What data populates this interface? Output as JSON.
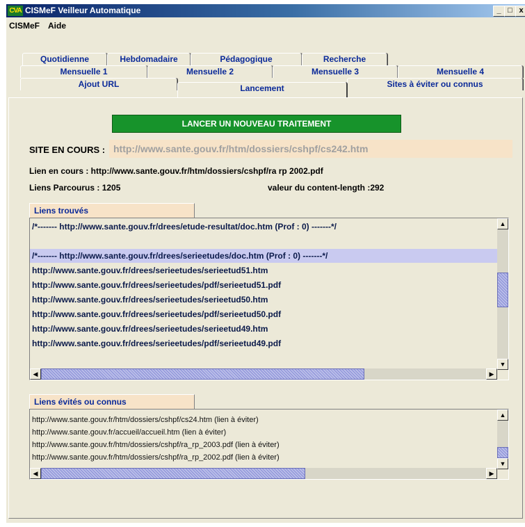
{
  "window": {
    "logo": "CVA",
    "title": "CISMeF Veilleur Automatique",
    "controls": [
      "_",
      "□",
      "x"
    ]
  },
  "menu": [
    "CISMeF",
    "Aide"
  ],
  "tabs": {
    "row1": [
      "Quotidienne",
      "Hebdomadaire",
      "Pédagogique",
      "Recherche"
    ],
    "row2": [
      "Mensuelle 1",
      "Mensuelle 2",
      "Mensuelle 3",
      "Mensuelle 4"
    ],
    "row3": [
      "Ajout URL",
      "Lancement",
      "Sites  à  éviter ou connus"
    ],
    "active": "Lancement"
  },
  "launch_button": "LANCER UN NOUVEAU TRAITEMENT",
  "site": {
    "label": "SITE EN COURS :",
    "value": "http://www.sante.gouv.fr/htm/dossiers/cshpf/cs242.htm"
  },
  "status": {
    "current_link": "Lien en cours : http://www.sante.gouv.fr/htm/dossiers/cshpf/ra  rp  2002.pdf",
    "links_visited": "Liens Parcourus : 1205",
    "content_length": "valeur du content-length :292"
  },
  "found": {
    "label": "Liens trouvés",
    "rows": [
      "/*-------   http://www.sante.gouv.fr/drees/etude-resultat/doc.htm (Prof : 0)   -------*/",
      "",
      "/*-------   http://www.sante.gouv.fr/drees/serieetudes/doc.htm (Prof : 0)   -------*/",
      "http://www.sante.gouv.fr/drees/serieetudes/serieetud51.htm",
      "http://www.sante.gouv.fr/drees/serieetudes/pdf/serieetud51.pdf",
      "http://www.sante.gouv.fr/drees/serieetudes/serieetud50.htm",
      "http://www.sante.gouv.fr/drees/serieetudes/pdf/serieetud50.pdf",
      "http://www.sante.gouv.fr/drees/serieetudes/serieetud49.htm",
      "http://www.sante.gouv.fr/drees/serieetudes/pdf/serieetud49.pdf"
    ]
  },
  "avoided": {
    "label": "Liens évités ou connus",
    "rows": [
      "http://www.sante.gouv.fr/htm/dossiers/cshpf/cs24.htm (lien à éviter)",
      "http://www.sante.gouv.fr/accueil/accueil.htm (lien à éviter)",
      "http://www.sante.gouv.fr/htm/dossiers/cshpf/ra_rp_2003.pdf (lien à éviter)",
      "http://www.sante.gouv.fr/htm/dossiers/cshpf/ra_rp_2002.pdf (lien à éviter)"
    ]
  },
  "scroll_glyphs": {
    "up": "▲",
    "down": "▼",
    "left": "◀",
    "right": "▶"
  },
  "colors": {
    "tab_text": "#0b2a99",
    "launch_button": "#17932b",
    "highlight": "#f7e3c8",
    "selected_row": "#c9caf0"
  }
}
